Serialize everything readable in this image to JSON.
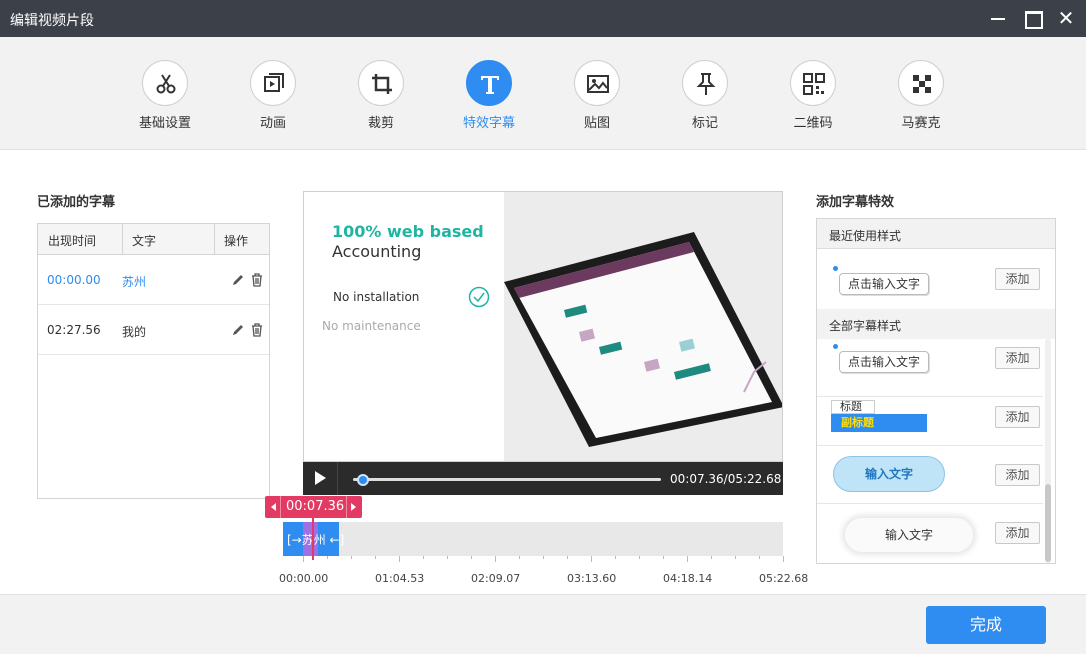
{
  "window": {
    "title": "编辑视频片段"
  },
  "tools": [
    {
      "label": "基础设置",
      "icon": "scissors-icon"
    },
    {
      "label": "动画",
      "icon": "animation-icon"
    },
    {
      "label": "裁剪",
      "icon": "crop-icon"
    },
    {
      "label": "特效字幕",
      "icon": "text-effect-icon",
      "active": true
    },
    {
      "label": "贴图",
      "icon": "sticker-icon"
    },
    {
      "label": "标记",
      "icon": "pin-icon"
    },
    {
      "label": "二维码",
      "icon": "qrcode-icon"
    },
    {
      "label": "马赛克",
      "icon": "mosaic-icon"
    }
  ],
  "subtitles": {
    "title": "已添加的字幕",
    "headers": [
      "出现时间",
      "文字",
      "操作"
    ],
    "rows": [
      {
        "time": "00:00.00",
        "text": "苏州",
        "active": true
      },
      {
        "time": "02:27.56",
        "text": "我的",
        "active": false
      }
    ]
  },
  "preview": {
    "headline_1": "100% web based",
    "headline_2": "Accounting",
    "line_1": "No installation",
    "line_2": "No maintenance"
  },
  "player": {
    "time": "00:07.36/05:22.68",
    "progress": 0.023
  },
  "timeline": {
    "current": "00:07.36",
    "clip_text": "[→苏州 ←]",
    "labels": [
      "00:00.00",
      "01:04.53",
      "02:09.07",
      "03:13.60",
      "04:18.14",
      "05:22.68"
    ]
  },
  "effects": {
    "title": "添加字幕特效",
    "recent_label": "最近使用样式",
    "all_label": "全部字幕样式",
    "add_label": "添加",
    "samples": {
      "click_input": "点击输入文字",
      "title": "标题",
      "subtitle": "副标题",
      "bone_text": "输入文字",
      "cloud_text": "输入文字"
    }
  },
  "footer": {
    "done_label": "完成"
  },
  "colors": {
    "accent": "#2f8cf0",
    "marker": "#e23a63",
    "titlebar": "#3c4049"
  }
}
